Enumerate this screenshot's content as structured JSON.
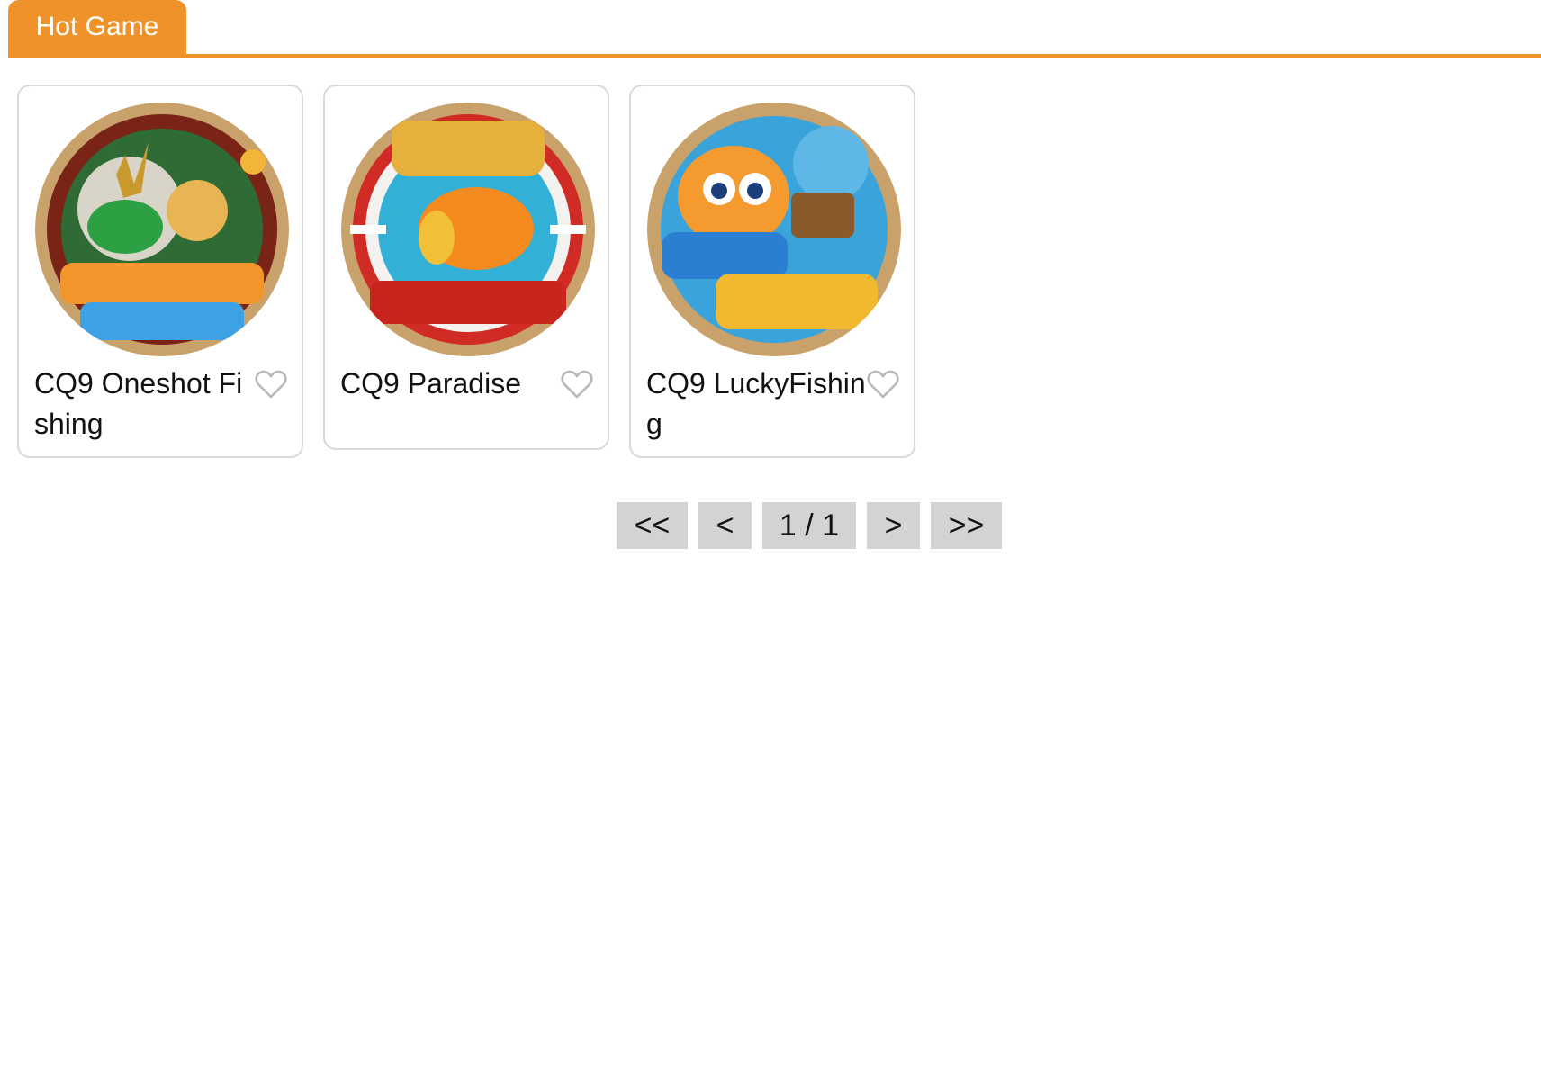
{
  "header": {
    "active_tab": "Hot Game",
    "accent_color": "#f0922a"
  },
  "games": [
    {
      "title": "CQ9 Oneshot Fishing",
      "favorite": false,
      "icon": "heart-outline-icon",
      "thumb_icon": "dragon-game-logo"
    },
    {
      "title": "CQ9 Paradise",
      "favorite": false,
      "icon": "heart-outline-icon",
      "thumb_icon": "clownfish-game-logo"
    },
    {
      "title": "CQ9 LuckyFishing",
      "favorite": false,
      "icon": "heart-outline-icon",
      "thumb_icon": "fish-game-logo"
    }
  ],
  "pagination": {
    "first": "<<",
    "prev": "<",
    "page_info": "1 / 1",
    "next": ">",
    "last": ">>"
  }
}
